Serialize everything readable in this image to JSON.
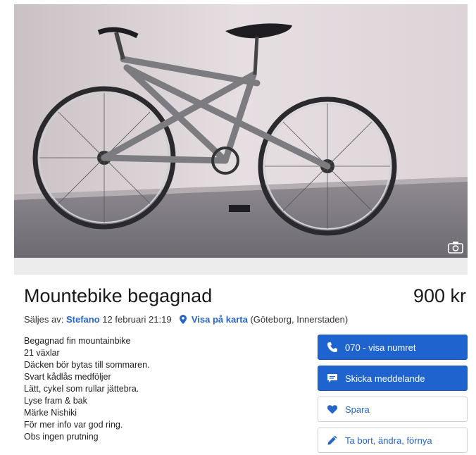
{
  "listing": {
    "title": "Mountebike begagnad",
    "price": "900 kr",
    "seller_prefix": "Säljes av:",
    "seller_name": "Stefano",
    "posted": "12 februari 21:19",
    "map_link": "Visa på karta",
    "location": "(Göteborg, Innerstaden)",
    "description": [
      "Begagnad fin mountainbike",
      "21 växlar",
      "Däcken bör bytas till sommaren.",
      "Svart kådlås medföljer",
      "Lätt, cykel som rullar jättebra.",
      "Lyse fram & bak",
      "Märke Nishiki",
      "För mer info var god ring.",
      "Obs ingen prutning"
    ]
  },
  "actions": {
    "phone_label": "070 - visa numret",
    "message_label": "Skicka meddelande",
    "save_label": "Spara",
    "edit_label": "Ta bort, ändra, förnya"
  },
  "icons": {
    "phone": "phone-icon",
    "message": "chat-bubble-icon",
    "save": "heart-icon",
    "edit": "pencil-icon",
    "map": "map-pin-icon",
    "gallery": "camera-icon"
  },
  "colors": {
    "accent": "#1f63cf",
    "link": "#2566c7"
  }
}
